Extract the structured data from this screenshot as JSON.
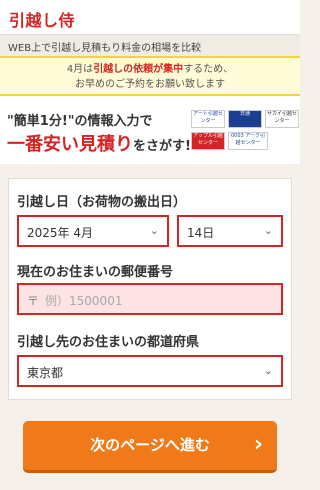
{
  "header": {
    "logo": "引越し侍"
  },
  "subbar": {
    "text": "WEB上で引越し見積もり料金の相場を比較"
  },
  "notice": {
    "line1_pre": "4月は",
    "line1_hl": "引越しの依頼が集中",
    "line1_post": "するため、",
    "line2": "お早めのご予約をお願い致します"
  },
  "promo": {
    "catch1": "\"簡単1分!\"の情報入力で",
    "catch2_red": "一番安い見積り",
    "catch2_tail": "をさがす!",
    "partner_logos": [
      "アート引越センター",
      "日通",
      "サカイ引越センター",
      "アップル引越センター",
      "0003 アーク引越センター"
    ]
  },
  "form": {
    "move_date_label": "引越し日（お荷物の搬出日）",
    "year_month": "2025年 4月",
    "day": "14日",
    "current_postal_label": "現在のお住まいの郵便番号",
    "postal_mark": "〒",
    "postal_placeholder": "例）1500001",
    "dest_pref_label": "引越し先のお住まいの都道府県",
    "dest_pref_value": "東京都",
    "chevron": "⌄"
  },
  "next_button": {
    "label": "次のページへ進む",
    "arrow": "›"
  },
  "colors": {
    "brand_red": "#d42424",
    "button_orange": "#f07a1a",
    "notice_yellow": "#fffbd6"
  }
}
